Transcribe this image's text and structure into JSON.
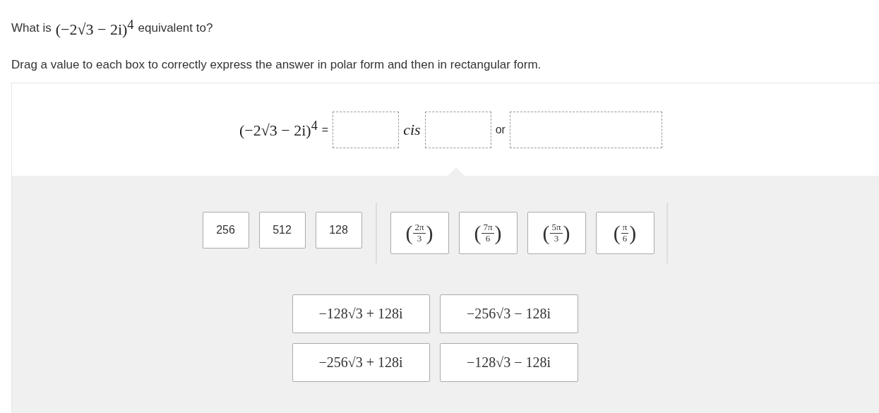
{
  "question": {
    "prefix": "What is",
    "expression": "(−2√3 − 2i)$^{4}$",
    "suffix": "equivalent to?"
  },
  "instruction": "Drag a value to each box to correctly express the answer in polar form and then in rectangular form.",
  "answer_row": [
    {
      "kind": "math",
      "text": "(−2√3 − 2i)$^{4}$"
    },
    {
      "kind": "text",
      "text": "="
    },
    {
      "kind": "drop"
    },
    {
      "kind": "italic",
      "text": "cis"
    },
    {
      "kind": "drop"
    },
    {
      "kind": "text",
      "text": "or"
    },
    {
      "kind": "widedrop"
    }
  ],
  "tile_groups": [
    {
      "tiles": [
        {
          "kind": "text",
          "text": "256"
        },
        {
          "kind": "text",
          "text": "512"
        },
        {
          "kind": "text",
          "text": "128"
        }
      ]
    },
    {
      "tiles": [
        {
          "kind": "fraction",
          "left": "(",
          "numerator": "2π",
          "denominator": "3",
          "right": ")"
        },
        {
          "kind": "fraction",
          "left": "(",
          "numerator": "7π",
          "denominator": "6",
          "right": ")"
        },
        {
          "kind": "fraction",
          "left": "(",
          "numerator": "5π",
          "denominator": "3",
          "right": ")"
        },
        {
          "kind": "fraction",
          "left": "(",
          "numerator": "π",
          "denominator": "6",
          "right": ")"
        }
      ]
    }
  ],
  "expression_tiles": [
    {
      "text": "−128√3 + 128i"
    },
    {
      "text": "−256√3 − 128i"
    },
    {
      "text": "−256√3 + 128i"
    },
    {
      "text": "−128√3 − 128i"
    }
  ]
}
